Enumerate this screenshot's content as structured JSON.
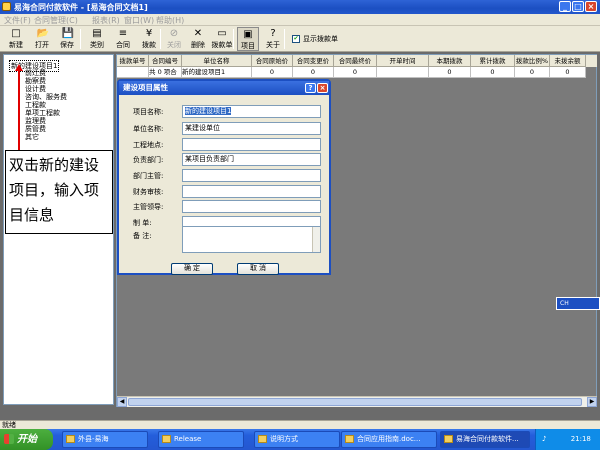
{
  "window": {
    "title": "易海合同付款软件 - [易海合同文档1]",
    "min": "_",
    "max": "□",
    "close": "×"
  },
  "menu": [
    "文件(F)",
    "合同管理(C)",
    "报表(R)",
    "窗口(W)",
    "帮助(H)"
  ],
  "toolbar": {
    "buttons": [
      {
        "label": "新建",
        "icon": "□",
        "name": "new-button",
        "disabled": false
      },
      {
        "label": "打开",
        "icon": "📂",
        "name": "open-button",
        "disabled": false
      },
      {
        "label": "保存",
        "icon": "💾",
        "name": "save-button",
        "disabled": false
      },
      {
        "label": "类别",
        "icon": "▤",
        "name": "category-button",
        "disabled": false
      },
      {
        "label": "合同",
        "icon": "≡",
        "name": "contract-button",
        "disabled": false
      },
      {
        "label": "拨款",
        "icon": "¥",
        "name": "payment-button",
        "disabled": false
      },
      {
        "label": "关闭",
        "icon": "⊘",
        "name": "close-doc-button",
        "disabled": true
      },
      {
        "label": "删除",
        "icon": "✕",
        "name": "delete-button",
        "disabled": false
      },
      {
        "label": "拨款单",
        "icon": "▭",
        "name": "payment-slip-button",
        "disabled": false
      },
      {
        "label": "项目",
        "icon": "▣",
        "name": "project-button",
        "disabled": false
      },
      {
        "label": "关于",
        "icon": "?",
        "name": "about-button",
        "disabled": false
      }
    ],
    "checkbox_label": "显示拨款单",
    "checkbox_mark": "✔"
  },
  "tree": {
    "root": "新的建设项目1",
    "children": [
      "前迁费",
      "勘察费",
      "设计费",
      "咨询、服务费",
      "工程款",
      "单项工程款",
      "监理费",
      "质管费",
      "其它"
    ]
  },
  "callout": "双击新的建设项目，输入项目信息",
  "grid": {
    "headers": [
      "拨款单号",
      "合同编号",
      "单位名称",
      "合同原始价",
      "合同变更价",
      "合同最终价",
      "开单时间",
      "本期拨款",
      "累计拨款",
      "拨款比例%",
      "未拨余额"
    ],
    "row": [
      "",
      "共 0 项合",
      "新的建设项目1",
      "0",
      "0",
      "0",
      "",
      "0",
      "0",
      "0",
      "0"
    ]
  },
  "dialog": {
    "title": "建设项目属性",
    "help": "?",
    "close": "×",
    "fields": [
      {
        "label": "项目名称:",
        "value": "新的建设项目1",
        "name": "project-name-field"
      },
      {
        "label": "单位名称:",
        "value": "某建设单位",
        "name": "unit-name-field"
      },
      {
        "label": "工程地点:",
        "value": "",
        "name": "site-field"
      },
      {
        "label": "负责部门:",
        "value": "某项目负责部门",
        "name": "department-field"
      },
      {
        "label": "部门主管:",
        "value": "",
        "name": "dept-head-field"
      },
      {
        "label": "财务审核:",
        "value": "",
        "name": "finance-review-field"
      },
      {
        "label": "主管领导:",
        "value": "",
        "name": "leader-field"
      },
      {
        "label": "制    单:",
        "value": "",
        "name": "preparer-field"
      }
    ],
    "memo_label": "备    注:",
    "ok": "确 定",
    "cancel": "取 消"
  },
  "floaty": "CH",
  "status": "就绪",
  "taskbar": {
    "start": "开始",
    "tasks": [
      "外县-易海",
      "Release",
      "说明方式",
      "合同应用指南.doc...",
      "易海合同付款软件..."
    ],
    "clock": "21:18"
  }
}
